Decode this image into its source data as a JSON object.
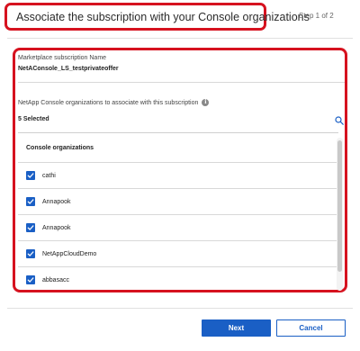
{
  "header": {
    "title": "Associate the subscription with your Console organizations",
    "step": "Step 1 of 2"
  },
  "subscription": {
    "label": "Marketplace subscription Name",
    "name": "NetAConsole_LS_testprivateoffer"
  },
  "organizations": {
    "label": "NetApp Console organizations to associate with this subscription",
    "info_icon": "i",
    "selected_count": "5 Selected",
    "column_header": "Console organizations",
    "items": [
      {
        "name": "cathi",
        "checked": true
      },
      {
        "name": "Annapook",
        "checked": true
      },
      {
        "name": "Annapook",
        "checked": true
      },
      {
        "name": "NetAppCloudDemo",
        "checked": true
      },
      {
        "name": "abbasacc",
        "checked": true
      }
    ]
  },
  "footer": {
    "next_label": "Next",
    "cancel_label": "Cancel"
  },
  "colors": {
    "accent": "#1a5fc5",
    "highlight": "#d6121f"
  }
}
